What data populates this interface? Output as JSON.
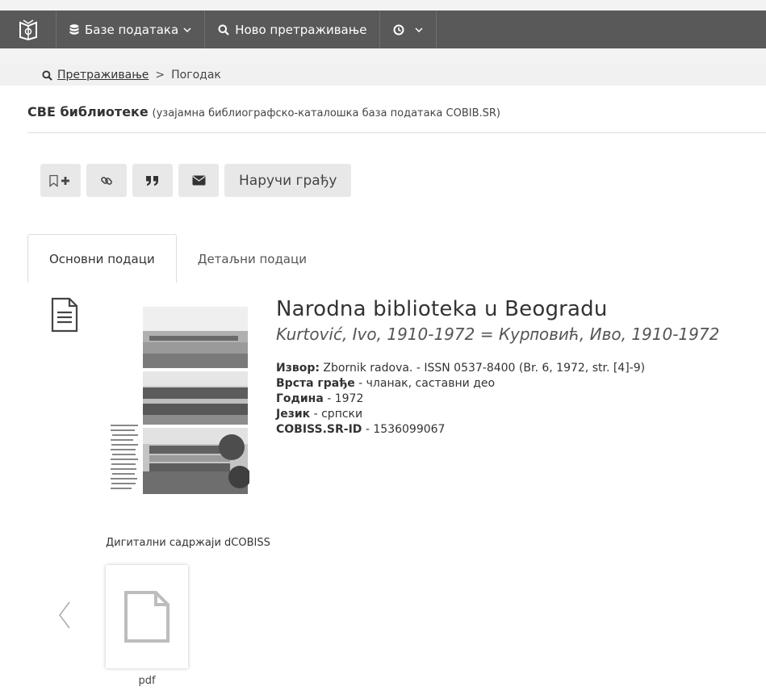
{
  "nav": {
    "databases_label": "Базе података",
    "new_search_label": "Ново претраживање"
  },
  "breadcrumb": {
    "search_link": "Претраживање",
    "separator": ">",
    "current": "Погодак"
  },
  "database": {
    "title": "СВЕ библиотеке",
    "subtitle": "(узајамна библиографско-каталошка база података COBIB.SR)"
  },
  "toolbar": {
    "order_label": "Наручи грађу"
  },
  "tabs": [
    {
      "label": "Основни подаци",
      "active": true
    },
    {
      "label": "Детаљни подаци",
      "active": false
    }
  ],
  "record": {
    "title": "Narodna biblioteka u Beogradu",
    "author": "Kurtović, Ivo, 1910-1972 = Курᴨовић, Иво, 1910-1972",
    "source_label": "Извор:",
    "source_value": " Zbornik radova. - ISSN 0537-8400 (Br. 6, 1972, str. [4]-9)",
    "type_label": "Врста грађе",
    "type_value": " - чланак, саставни део",
    "year_label": "Година",
    "year_value": " - 1972",
    "language_label": "Језик",
    "language_value": " - српски",
    "id_label": "COBISS.SR-ID",
    "id_value": " - 1536099067"
  },
  "digital": {
    "title": "Дигитални садржаји dCOBISS",
    "file_type": "pdf"
  },
  "colors": {
    "navbar": "#595959",
    "button_bg": "#e8e8e8"
  }
}
